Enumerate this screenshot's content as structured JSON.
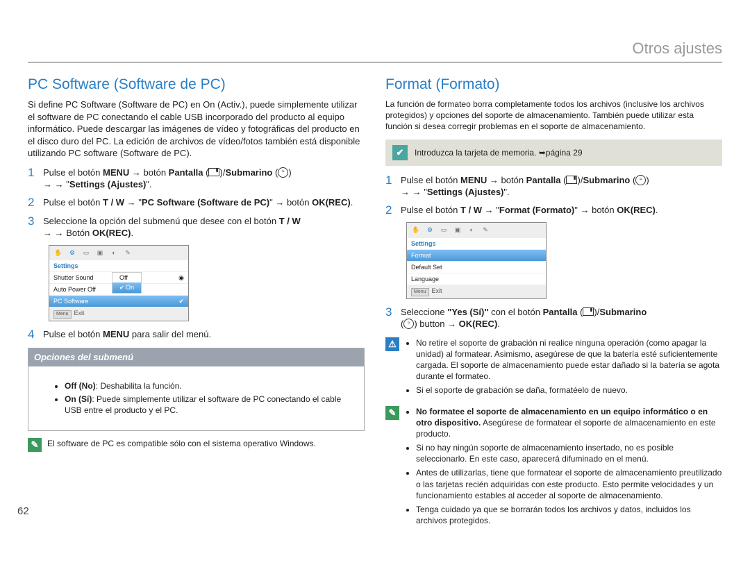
{
  "header": {
    "title": "Otros ajustes"
  },
  "pageNumber": "62",
  "left": {
    "title": "PC Software (Software de PC)",
    "intro": "Si define PC Software (Software de PC) en On (Activ.), puede simplemente utilizar el software de PC conectando el cable USB incorporado del producto al equipo informático. Puede descargar las imágenes de vídeo y fotográficas del producto en el disco duro del PC. La edición de archivos de vídeo/fotos también está disponible utilizando PC software (Software de PC).",
    "steps": {
      "s1a": "Pulse el botón ",
      "s1_menu": "MENU",
      "s1b": " → botón ",
      "s1_pantalla": "Pantalla",
      "s1c": "/",
      "s1_sub": "Submarino",
      "s1d": " → \"",
      "s1_settings": "Settings (Ajustes)",
      "s1e": "\".",
      "s2a": "Pulse el botón ",
      "s2_tw": "T / W",
      "s2b": " → \"",
      "s2_pc": "PC Software (Software de PC)",
      "s2c": "\" → botón ",
      "s2_ok": "OK(REC)",
      "s2d": ".",
      "s3a": "Seleccione la opción del submenú que desee con el botón ",
      "s3_tw": "T / W",
      "s3b": " → Botón ",
      "s3_ok": "OK(REC)",
      "s3c": ".",
      "s4a": "Pulse el botón ",
      "s4_menu": "MENU",
      "s4b": " para salir del menú."
    },
    "camshot": {
      "header": "Settings",
      "r1": "Shutter Sound",
      "r2": "Auto Power Off",
      "r3": "PC Software",
      "optOff": "Off",
      "optOn": "On",
      "exit": "Exit",
      "menuTag": "Menu"
    },
    "submenu": {
      "title": "Opciones del submenú",
      "offLabel": "Off (No)",
      "offText": ": Deshabilita la función.",
      "onLabel": "On (Sí)",
      "onText": ": Puede simplemente utilizar el software de PC conectando el cable USB entre el producto y el PC."
    },
    "footnote": "El software de PC es compatible sólo con el sistema operativo Windows."
  },
  "right": {
    "title": "Format (Formato)",
    "intro": "La función de formateo borra completamente todos los archivos (inclusive los archivos protegidos) y opciones del soporte de almacenamiento. También puede utilizar esta función si desea corregir problemas en el soporte de almacenamiento.",
    "callout": "Introduzca la tarjeta de memoria. ➥página 29",
    "steps": {
      "s1a": "Pulse el botón ",
      "s1_menu": "MENU",
      "s1b": " → botón ",
      "s1_pantalla": "Pantalla",
      "s1c": "/",
      "s1_sub": "Submarino",
      "s1d": " → \"",
      "s1_settings": "Settings (Ajustes)",
      "s1e": "\".",
      "s2a": "Pulse el botón ",
      "s2_tw": "T / W",
      "s2b": " → \"",
      "s2_fmt": "Format (Formato)",
      "s2c": "\" → botón ",
      "s2_ok": "OK(REC)",
      "s2d": ".",
      "s3a": "Seleccione ",
      "s3_yes": "\"Yes (Sí)\"",
      "s3b": " con el botón ",
      "s3_pantalla": "Pantalla",
      "s3c": "/",
      "s3_sub": "Submarino",
      "s3d": " button → ",
      "s3_ok": "OK(REC)",
      "s3e": "."
    },
    "camshot": {
      "header": "Settings",
      "r1": "Format",
      "r2": "Default Set",
      "r3": "Language",
      "exit": "Exit",
      "menuTag": "Menu"
    },
    "warn": {
      "b1": "No retire el soporte de grabación ni realice ninguna operación (como apagar la unidad) al formatear. Asimismo, asegúrese de que la batería esté suficientemente cargada. El soporte de almacenamiento puede estar dañado si la batería se agota durante el formateo.",
      "b2": "Si el soporte de grabación se daña, formatéelo de nuevo."
    },
    "info": {
      "b1a": "No formatee el soporte de almacenamiento en un equipo informático o en otro dispositivo.",
      "b1b": " Asegúrese de formatear el soporte de almacenamiento en este producto.",
      "b2": "Si no hay ningún soporte de almacenamiento insertado, no es posible seleccionarlo. En este caso, aparecerá difuminado en el menú.",
      "b3": "Antes de utilizarlas, tiene que formatear el soporte de almacenamiento preutilizado o las tarjetas recién adquiridas con este producto. Esto permite velocidades y un funcionamiento estables al acceder al soporte de almacenamiento.",
      "b4": "Tenga cuidado ya que se borrarán todos los archivos y datos, incluidos los archivos protegidos."
    }
  }
}
